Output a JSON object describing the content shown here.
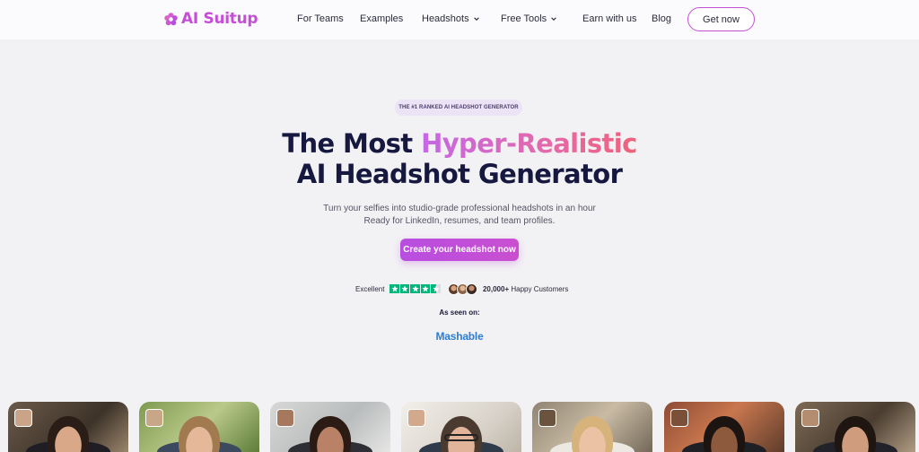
{
  "nav": {
    "logo_text": "AI Suitup",
    "items": [
      {
        "label": "For Teams",
        "dropdown": false
      },
      {
        "label": "Examples",
        "dropdown": false
      },
      {
        "label": "Headshots",
        "dropdown": true
      },
      {
        "label": "Free Tools",
        "dropdown": true
      },
      {
        "label": "Earn with us",
        "dropdown": false
      },
      {
        "label": "Blog",
        "dropdown": false
      }
    ],
    "cta_label": "Get now"
  },
  "hero": {
    "badge": "THE #1 RANKED AI HEADSHOT GENERATOR",
    "title_part1": "The Most ",
    "title_highlight": "Hyper-Realistic",
    "title_line2": "AI Headshot Generator",
    "subtitle_line1": "Turn your selfies into studio-grade professional headshots in an hour",
    "subtitle_line2": "Ready for LinkedIn, resumes, and team profiles.",
    "cta_label": "Create your headshot now"
  },
  "social_proof": {
    "rating_word": "Excellent",
    "stars": 4.5,
    "customers_count": "20,000+",
    "customers_label": "Happy Customers"
  },
  "press": {
    "label": "As seen on:",
    "logos": [
      "Mashable"
    ]
  },
  "colors": {
    "brand": "#c44fd6",
    "title": "#16183f",
    "trustpilot_green": "#00b67a",
    "mashable_blue": "#2d7dd2"
  },
  "headshot_cards": [
    {
      "alt": "woman-office-headshot"
    },
    {
      "alt": "man-outdoor-headshot"
    },
    {
      "alt": "woman-smiling-headshot"
    },
    {
      "alt": "man-glasses-headshot"
    },
    {
      "alt": "woman-blonde-headshot"
    },
    {
      "alt": "man-brick-wall-headshot"
    },
    {
      "alt": "woman-dark-hair-headshot"
    }
  ]
}
